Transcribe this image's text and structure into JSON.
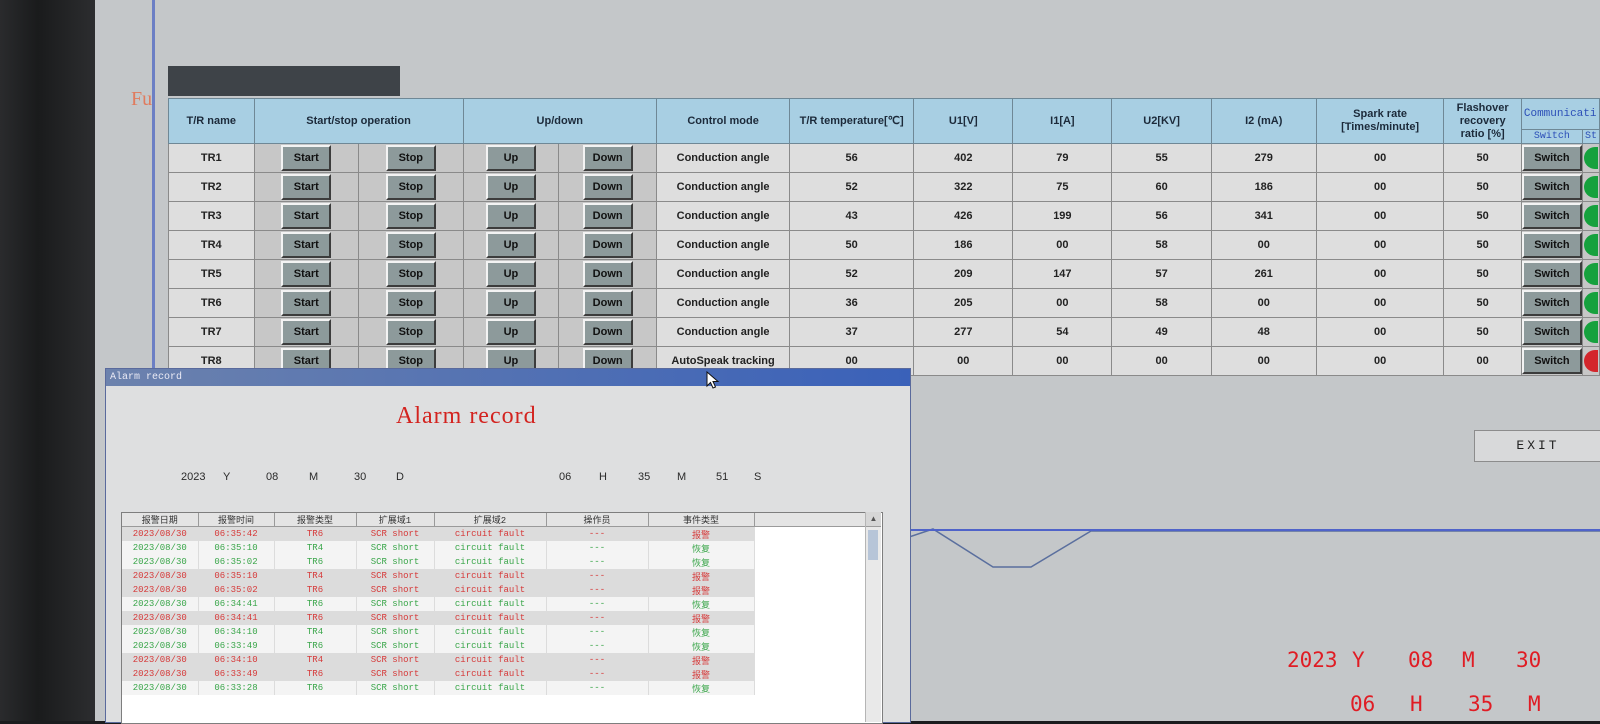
{
  "side_mark": "Fu",
  "tr_table": {
    "headers": {
      "name": "T/R name",
      "startstop": "Start/stop operation",
      "updown": "Up/down",
      "control": "Control mode",
      "temp": "T/R temperature[℃]",
      "u1": "U1[V]",
      "i1": "I1[A]",
      "u2": "U2[KV]",
      "i2": "I2 (mA)",
      "spark_l1": "Spark rate",
      "spark_l2": "[Times/minute]",
      "flash_l1": "Flashover",
      "flash_l2": "recovery ratio [%]",
      "comm": "Communicati",
      "switch": "Switch",
      "status": "St"
    },
    "buttons": {
      "start": "Start",
      "stop": "Stop",
      "up": "Up",
      "down": "Down",
      "switch": "Switch"
    },
    "rows": [
      {
        "name": "TR1",
        "control": "Conduction angle",
        "temp": "56",
        "u1": "402",
        "i1": "79",
        "u2": "55",
        "i2": "279",
        "spark": "00",
        "flash": "50",
        "status": "green"
      },
      {
        "name": "TR2",
        "control": "Conduction angle",
        "temp": "52",
        "u1": "322",
        "i1": "75",
        "u2": "60",
        "i2": "186",
        "spark": "00",
        "flash": "50",
        "status": "green"
      },
      {
        "name": "TR3",
        "control": "Conduction angle",
        "temp": "43",
        "u1": "426",
        "i1": "199",
        "u2": "56",
        "i2": "341",
        "spark": "00",
        "flash": "50",
        "status": "green"
      },
      {
        "name": "TR4",
        "control": "Conduction angle",
        "temp": "50",
        "u1": "186",
        "i1": "00",
        "u2": "58",
        "i2": "00",
        "spark": "00",
        "flash": "50",
        "status": "green"
      },
      {
        "name": "TR5",
        "control": "Conduction angle",
        "temp": "52",
        "u1": "209",
        "i1": "147",
        "u2": "57",
        "i2": "261",
        "spark": "00",
        "flash": "50",
        "status": "green"
      },
      {
        "name": "TR6",
        "control": "Conduction angle",
        "temp": "36",
        "u1": "205",
        "i1": "00",
        "u2": "58",
        "i2": "00",
        "spark": "00",
        "flash": "50",
        "status": "green"
      },
      {
        "name": "TR7",
        "control": "Conduction angle",
        "temp": "37",
        "u1": "277",
        "i1": "54",
        "u2": "49",
        "i2": "48",
        "spark": "00",
        "flash": "50",
        "status": "green"
      },
      {
        "name": "TR8",
        "control": "AutoSpeak tracking",
        "temp": "00",
        "u1": "00",
        "i1": "00",
        "u2": "00",
        "i2": "00",
        "spark": "00",
        "flash": "00",
        "status": "red"
      }
    ]
  },
  "exit_label": "EXIT",
  "big_clock": {
    "year": "2023",
    "y": "Y",
    "month": "08",
    "m": "M",
    "day": "30",
    "hour": "06",
    "h": "H",
    "minute": "35",
    "m2": "M"
  },
  "alarm_window": {
    "title": "Alarm record",
    "heading": "Alarm record",
    "datetime": {
      "year": "2023",
      "y": "Y",
      "month": "08",
      "m": "M",
      "day": "30",
      "d": "D",
      "hour": "06",
      "h": "H",
      "minute": "35",
      "m2": "M",
      "second": "51",
      "s": "S"
    },
    "columns": [
      "报警日期",
      "报警时间",
      "报警类型",
      "扩展域1",
      "扩展域2",
      "操作员",
      "事件类型"
    ],
    "rows": [
      {
        "date": "2023/08/30",
        "time": "06:35:42",
        "type": "TR6",
        "ext1": "SCR short",
        "ext2": "circuit fault",
        "op": "---",
        "event": "报警",
        "kind": "alarm"
      },
      {
        "date": "2023/08/30",
        "time": "06:35:10",
        "type": "TR4",
        "ext1": "SCR short",
        "ext2": "circuit fault",
        "op": "---",
        "event": "恢复",
        "kind": "recover"
      },
      {
        "date": "2023/08/30",
        "time": "06:35:02",
        "type": "TR6",
        "ext1": "SCR short",
        "ext2": "circuit fault",
        "op": "---",
        "event": "恢复",
        "kind": "recover"
      },
      {
        "date": "2023/08/30",
        "time": "06:35:10",
        "type": "TR4",
        "ext1": "SCR short",
        "ext2": "circuit fault",
        "op": "---",
        "event": "报警",
        "kind": "alarm"
      },
      {
        "date": "2023/08/30",
        "time": "06:35:02",
        "type": "TR6",
        "ext1": "SCR short",
        "ext2": "circuit fault",
        "op": "---",
        "event": "报警",
        "kind": "alarm"
      },
      {
        "date": "2023/08/30",
        "time": "06:34:41",
        "type": "TR6",
        "ext1": "SCR short",
        "ext2": "circuit fault",
        "op": "---",
        "event": "恢复",
        "kind": "recover"
      },
      {
        "date": "2023/08/30",
        "time": "06:34:41",
        "type": "TR6",
        "ext1": "SCR short",
        "ext2": "circuit fault",
        "op": "---",
        "event": "报警",
        "kind": "alarm"
      },
      {
        "date": "2023/08/30",
        "time": "06:34:10",
        "type": "TR4",
        "ext1": "SCR short",
        "ext2": "circuit fault",
        "op": "---",
        "event": "恢复",
        "kind": "recover"
      },
      {
        "date": "2023/08/30",
        "time": "06:33:49",
        "type": "TR6",
        "ext1": "SCR short",
        "ext2": "circuit fault",
        "op": "---",
        "event": "恢复",
        "kind": "recover"
      },
      {
        "date": "2023/08/30",
        "time": "06:34:10",
        "type": "TR4",
        "ext1": "SCR short",
        "ext2": "circuit fault",
        "op": "---",
        "event": "报警",
        "kind": "alarm"
      },
      {
        "date": "2023/08/30",
        "time": "06:33:49",
        "type": "TR6",
        "ext1": "SCR short",
        "ext2": "circuit fault",
        "op": "---",
        "event": "报警",
        "kind": "alarm"
      },
      {
        "date": "2023/08/30",
        "time": "06:33:28",
        "type": "TR6",
        "ext1": "SCR short",
        "ext2": "circuit fault",
        "op": "---",
        "event": "恢复",
        "kind": "recover"
      }
    ]
  },
  "colors": {
    "alarm_text": "#d63a3a",
    "recover_text": "#3aa64a",
    "header_blue": "#a8cfe3",
    "clock_red": "#e01c24",
    "status_ok": "#16a13d",
    "status_fault": "#d3262c"
  },
  "icons": {
    "cursor": "mouse-pointer-icon",
    "scroll_up": "scroll-up-arrow-icon"
  }
}
